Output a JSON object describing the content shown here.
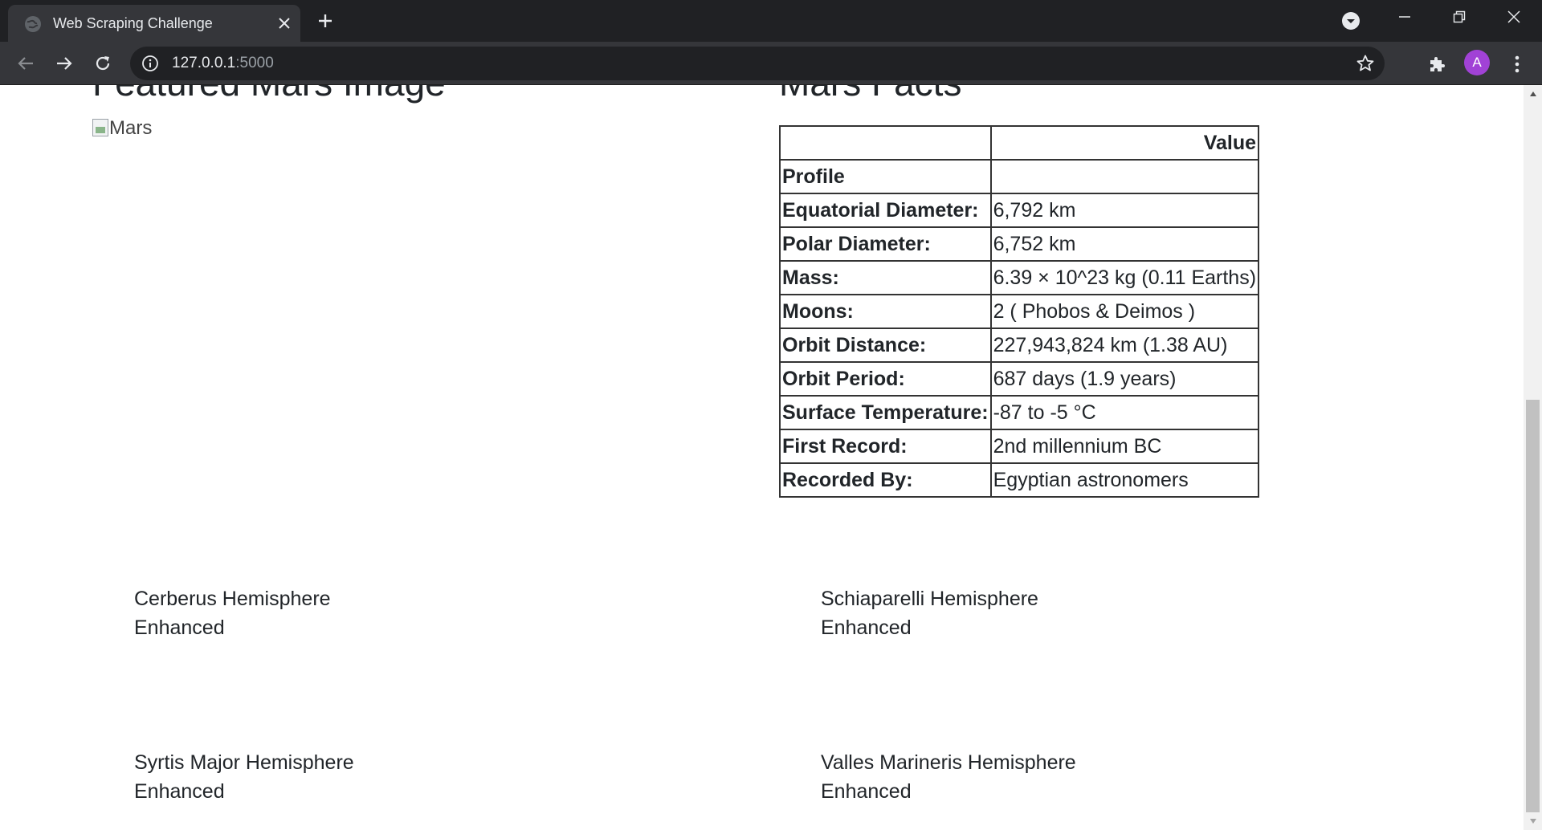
{
  "browser": {
    "tab_title": "Web Scraping Challenge",
    "url_host": "127.0.0.1",
    "url_port": ":5000",
    "profile_initial": "A",
    "colors": {
      "chrome_dark": "#202124",
      "toolbar": "#35363a",
      "avatar": "#a142d6"
    }
  },
  "page": {
    "featured_heading": "Featured Mars Image",
    "featured_image_alt": "Mars",
    "facts_heading": "Mars Facts",
    "facts_table": {
      "header_value": "Value",
      "rows": [
        {
          "label": "Profile",
          "value": ""
        },
        {
          "label": "Equatorial Diameter:",
          "value": "6,792 km"
        },
        {
          "label": "Polar Diameter:",
          "value": "6,752 km"
        },
        {
          "label": "Mass:",
          "value": "6.39 × 10^23 kg (0.11 Earths)"
        },
        {
          "label": "Moons:",
          "value": "2 ( Phobos & Deimos )"
        },
        {
          "label": "Orbit Distance:",
          "value": "227,943,824 km (1.38 AU)"
        },
        {
          "label": "Orbit Period:",
          "value": "687 days (1.9 years)"
        },
        {
          "label": "Surface Temperature:",
          "value": "-87 to -5 °C"
        },
        {
          "label": "First Record:",
          "value": "2nd millennium BC"
        },
        {
          "label": "Recorded By:",
          "value": "Egyptian astronomers"
        }
      ]
    },
    "hemispheres": [
      {
        "name": "Cerberus Hemisphere",
        "sub": "Enhanced"
      },
      {
        "name": "Schiaparelli Hemisphere",
        "sub": "Enhanced"
      },
      {
        "name": "Syrtis Major Hemisphere",
        "sub": "Enhanced"
      },
      {
        "name": "Valles Marineris Hemisphere",
        "sub": "Enhanced"
      }
    ]
  }
}
